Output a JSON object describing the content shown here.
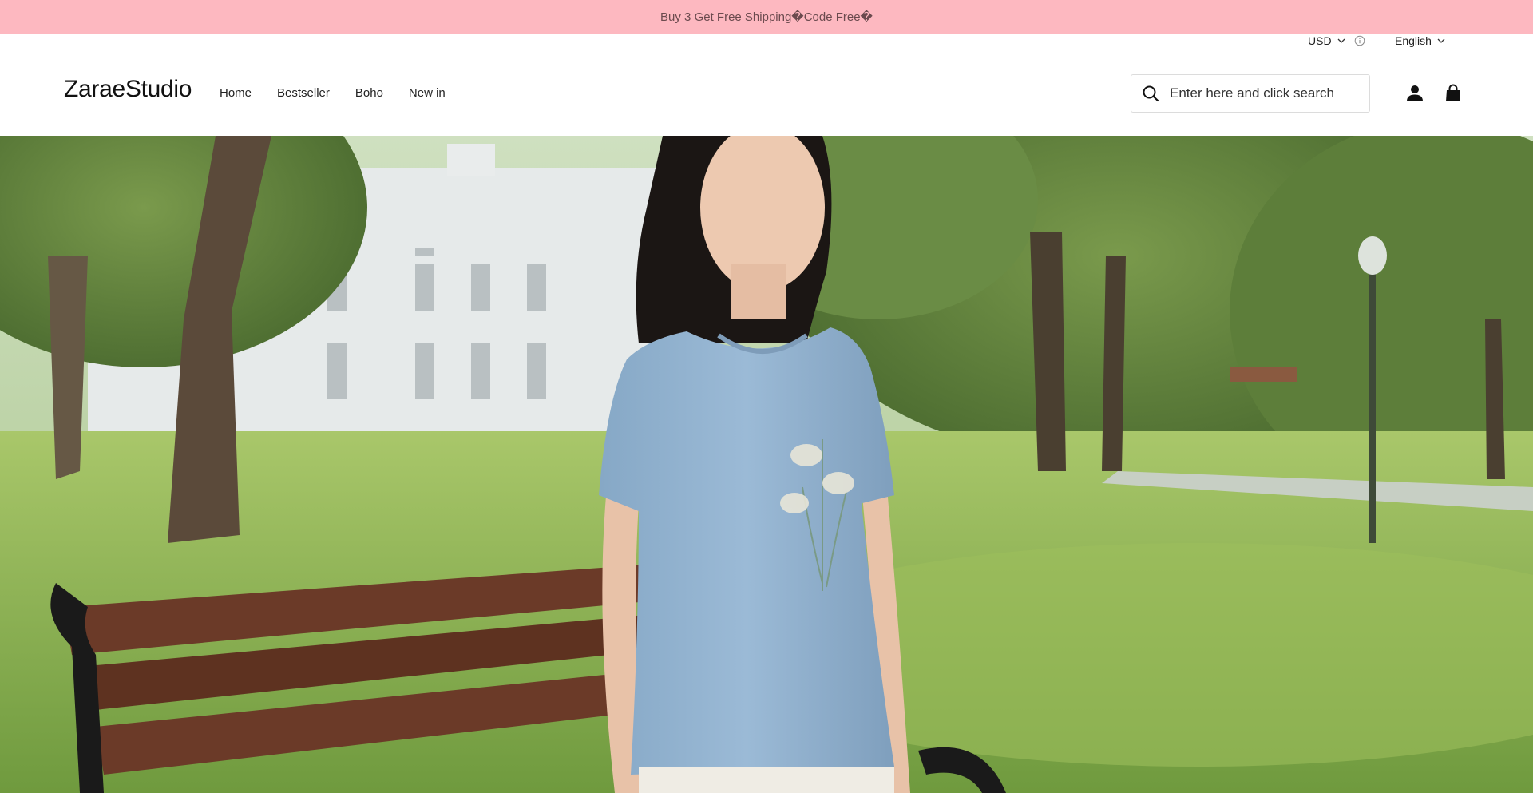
{
  "announcement": {
    "text": "Buy 3 Get Free Shipping�Code Free�"
  },
  "utility": {
    "currency": "USD",
    "language": "English"
  },
  "header": {
    "logo": "ZaraeStudio",
    "nav": [
      {
        "label": "Home"
      },
      {
        "label": "Bestseller"
      },
      {
        "label": "Boho"
      },
      {
        "label": "New in"
      }
    ],
    "search": {
      "placeholder": "Enter here and click search",
      "value": ""
    }
  },
  "icons": {
    "search": "search-icon",
    "account": "user-icon",
    "cart": "shopping-bag-icon",
    "currency_dropdown": "chevron-down-icon",
    "currency_info": "info-icon",
    "language_dropdown": "chevron-down-icon"
  },
  "hero": {
    "image": "woman in light blue floral-embroidered t-shirt standing in a park near a wooden bench"
  },
  "colors": {
    "announcement_bg": "#fdb8c0",
    "text": "#111111"
  }
}
